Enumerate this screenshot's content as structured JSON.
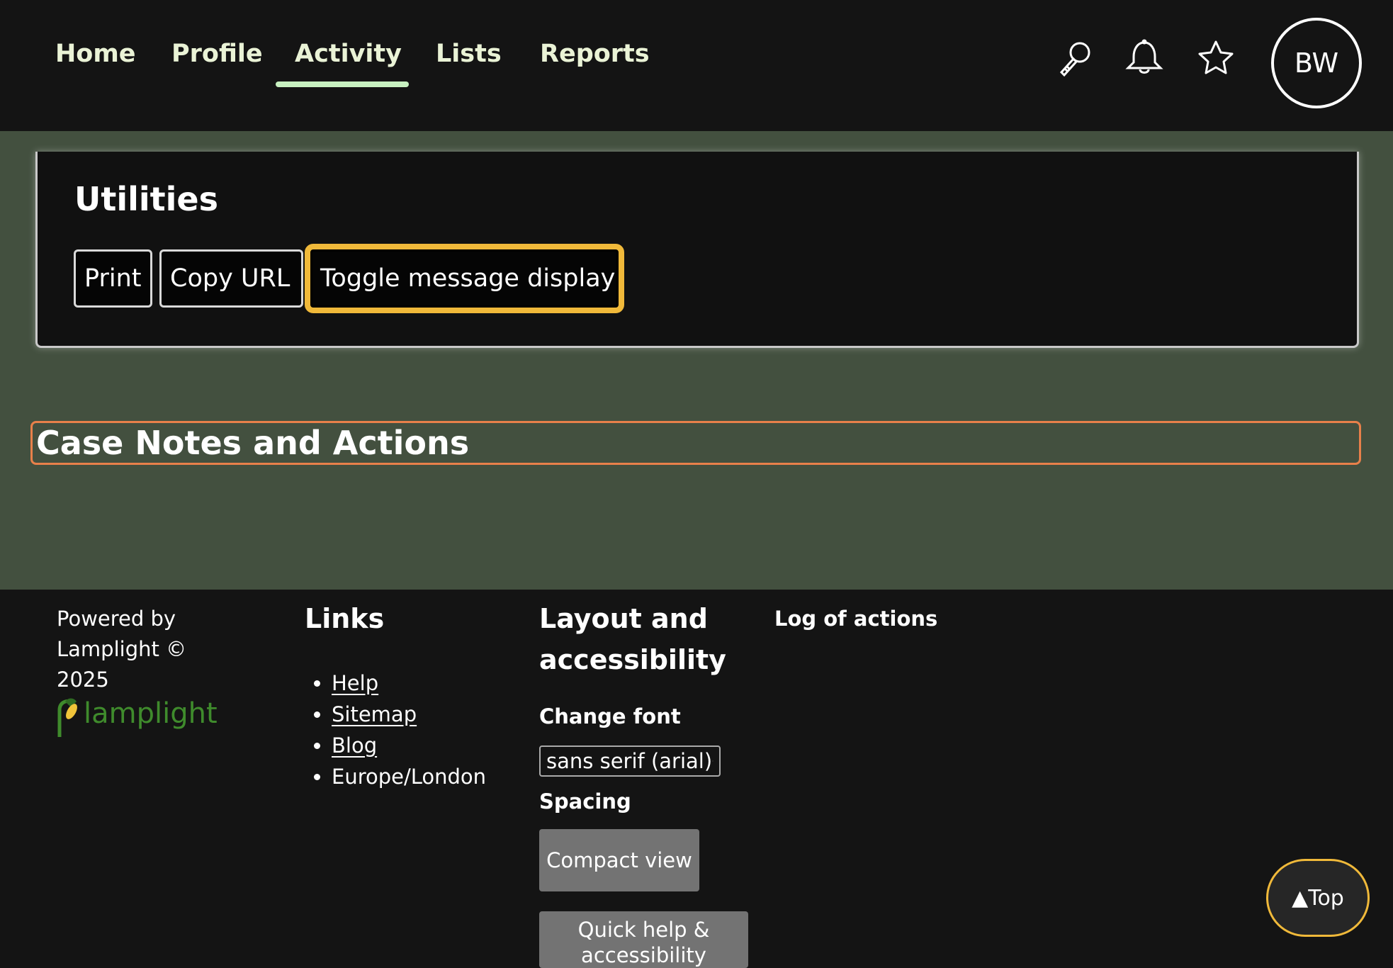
{
  "nav": {
    "tabs": [
      {
        "label": "Home"
      },
      {
        "label": "Profile"
      },
      {
        "label": "Activity",
        "active": true
      },
      {
        "label": "Lists"
      },
      {
        "label": "Reports"
      }
    ],
    "icons": [
      "search-icon",
      "bell-icon",
      "star-icon"
    ],
    "avatar_initials": "BW"
  },
  "utilities": {
    "title": "Utilities",
    "buttons": {
      "print": "Print",
      "copy_url": "Copy URL",
      "toggle": "Toggle message display"
    }
  },
  "case_notes": {
    "heading": "Case Notes and Actions"
  },
  "footer": {
    "powered_by": "Powered by Lamplight © 2025",
    "logo_text": "lamplight",
    "links": {
      "heading": "Links",
      "items": [
        "Help",
        "Sitemap",
        "Blog"
      ],
      "timezone": "Europe/London"
    },
    "layout": {
      "heading": "Layout and accessibility",
      "change_font_label": "Change font",
      "font_value": "sans serif (arial)",
      "spacing_label": "Spacing",
      "compact_view": "Compact view",
      "quick_help": "Quick help & accessibility"
    },
    "log_heading": "Log of actions",
    "top_button": "▲Top"
  },
  "colors": {
    "background_dark": "#141414",
    "main_green": "#43503f",
    "active_tab_underline": "#c7f0c0",
    "focus_ring": "#f0b93a",
    "heading_outline": "#e8804a",
    "logo_green": "#3f8b2c"
  }
}
